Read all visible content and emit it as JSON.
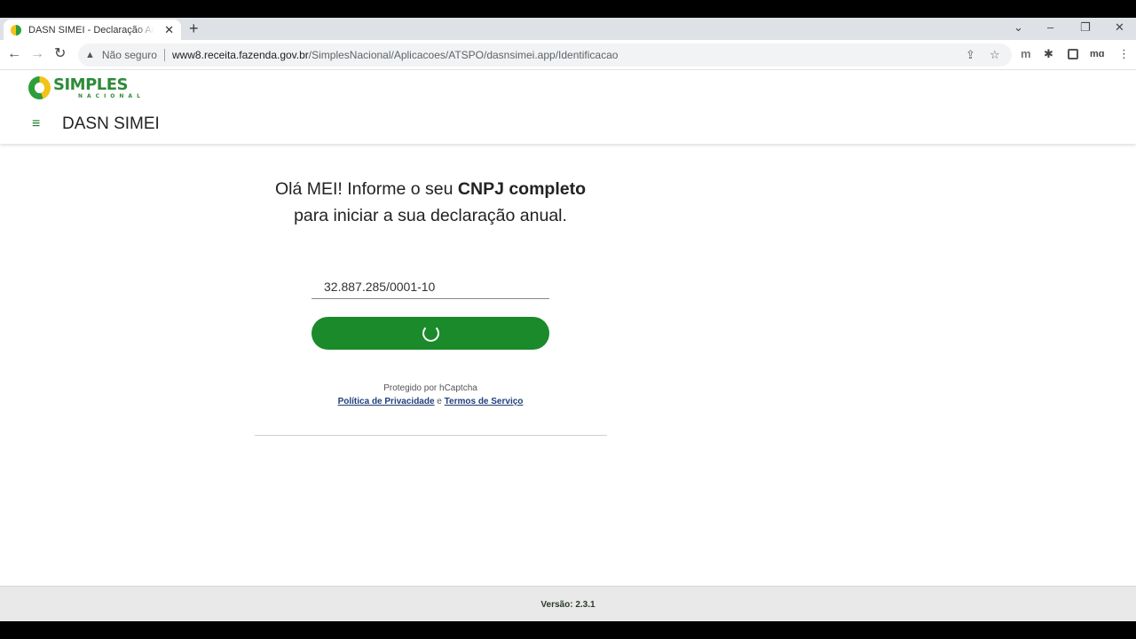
{
  "browser": {
    "tab_title": "DASN SIMEI - Declaração Anual do",
    "tab_close": "✕",
    "new_tab": "+",
    "window_controls": {
      "chevron": "⌄",
      "minimize": "–",
      "restore": "❐",
      "close": "✕"
    },
    "nav": {
      "back": "←",
      "forward": "→",
      "reload": "↻"
    },
    "security_warning_icon": "▲",
    "security_text": "Não seguro",
    "url_host": "www8.receita.fazenda.gov.br",
    "url_path": "/SimplesNacional/Aplicacoes/ATSPO/dasnsimei.app/Identificacao",
    "omnibox_icons": {
      "share": "⇪",
      "bookmark": "☆"
    },
    "toolbar_icons": {
      "extension_m": "m",
      "extensions": "✱",
      "profile": "mɑ",
      "menu": "⋮"
    }
  },
  "site": {
    "logo_main": "SIMPLES",
    "logo_sub": "NACIONAL",
    "menu_icon": "≡",
    "app_title": "DASN SIMEI"
  },
  "main": {
    "headline_part1": "Olá MEI! Informe o seu ",
    "headline_bold": "CNPJ completo",
    "headline_line2": "para iniciar a sua declaração anual.",
    "cnpj_value": "32.887.285/0001-10",
    "captcha_text": "Protegido por hCaptcha",
    "privacy_link": "Política de Privacidade",
    "and_text": " e ",
    "terms_link": "Termos de Serviço"
  },
  "footer": {
    "version": "Versão: 2.3.1"
  },
  "colors": {
    "brand_green": "#1a8a2a",
    "logo_yellow": "#f2c318",
    "link_blue": "#1f3f7a"
  }
}
